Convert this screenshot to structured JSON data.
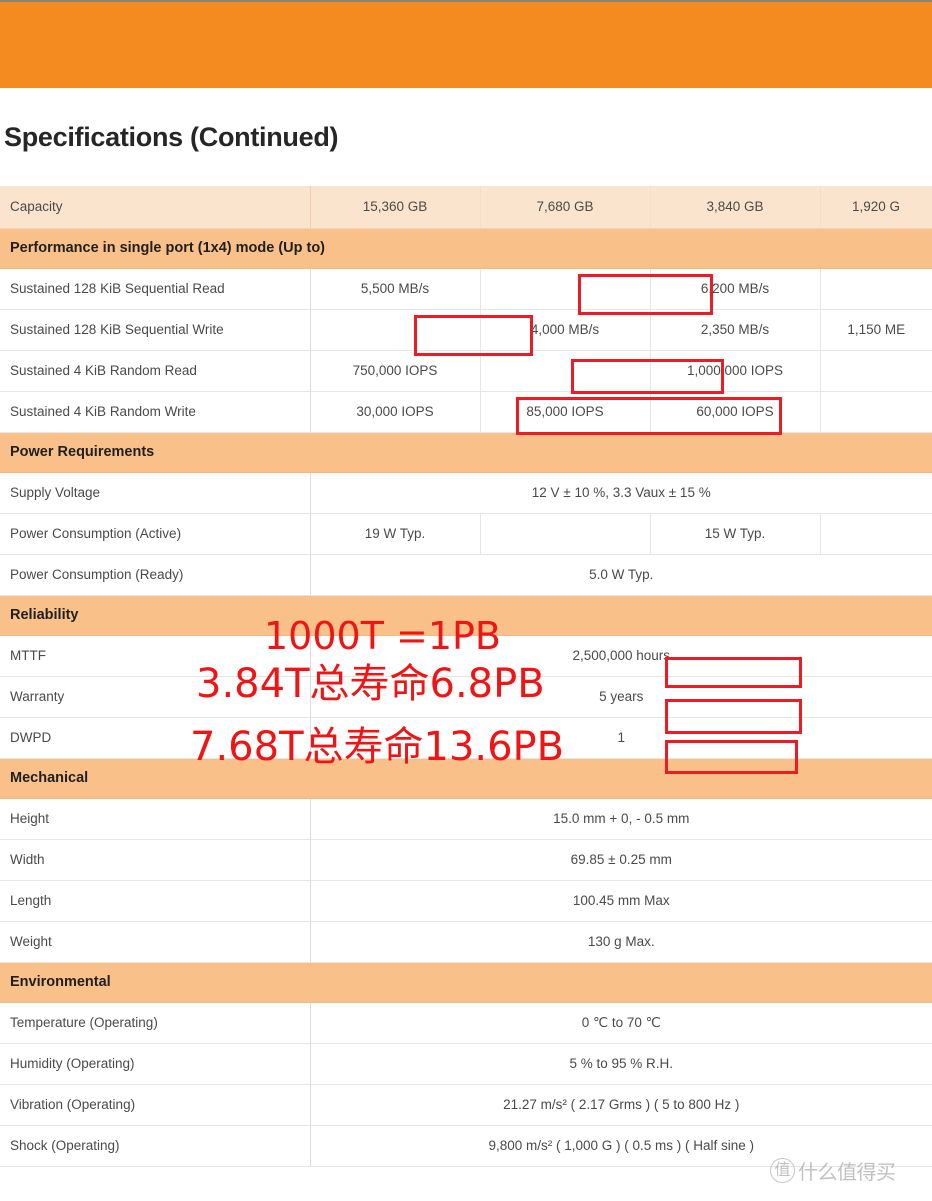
{
  "banner": {
    "color": "#F38B21"
  },
  "page_title": "Specifications (Continued)",
  "table": {
    "capacity_row": {
      "label": "Capacity",
      "values": [
        "15,360 GB",
        "7,680 GB",
        "3,840 GB",
        "1,920 G"
      ]
    },
    "sections": [
      {
        "header": "Performance in single port (1x4) mode (Up to)",
        "rows": [
          {
            "label": "Sustained 128 KiB Sequential Read",
            "cells": [
              "5,500 MB/s",
              "",
              "6,200 MB/s",
              ""
            ]
          },
          {
            "label": "Sustained 128 KiB Sequential Write",
            "cells": [
              "",
              "4,000 MB/s",
              "2,350 MB/s",
              "1,150 ME"
            ]
          },
          {
            "label": "Sustained 4 KiB Random Read",
            "cells": [
              "750,000 IOPS",
              "",
              "1,000,000 IOPS",
              ""
            ]
          },
          {
            "label": "Sustained 4 KiB Random Write",
            "cells": [
              "30,000 IOPS",
              "85,000 IOPS",
              "60,000 IOPS",
              ""
            ]
          }
        ]
      },
      {
        "header": "Power Requirements",
        "rows": [
          {
            "label": "Supply Voltage",
            "merged": "12 V ± 10 %, 3.3 Vaux ± 15 %"
          },
          {
            "label": "Power Consumption (Active)",
            "cells": [
              "19 W Typ.",
              "",
              "15 W Typ.",
              ""
            ]
          },
          {
            "label": "Power Consumption (Ready)",
            "merged": "5.0 W Typ."
          }
        ]
      },
      {
        "header": "Reliability",
        "rows": [
          {
            "label": "MTTF",
            "merged": "2,500,000 hours"
          },
          {
            "label": "Warranty",
            "merged": "5 years"
          },
          {
            "label": "DWPD",
            "merged": "1"
          }
        ]
      },
      {
        "header": "Mechanical",
        "rows": [
          {
            "label": "Height",
            "merged": "15.0 mm + 0,  - 0.5 mm"
          },
          {
            "label": "Width",
            "merged": "69.85 ± 0.25 mm"
          },
          {
            "label": "Length",
            "merged": "100.45 mm Max"
          },
          {
            "label": "Weight",
            "merged": "130 g Max."
          }
        ]
      },
      {
        "header": "Environmental",
        "rows": [
          {
            "label": "Temperature (Operating)",
            "merged": "0 ℃ to 70 ℃"
          },
          {
            "label": "Humidity  (Operating)",
            "merged": "5 % to 95 % R.H."
          },
          {
            "label": "Vibration (Operating)",
            "merged": "21.27 m/s² ( 2.17 Grms ) ( 5 to 800 Hz )"
          },
          {
            "label": "Shock (Operating)",
            "merged": "9,800 m/s² ( 1,000 G ) ( 0.5 ms ) ( Half sine )"
          }
        ]
      }
    ]
  },
  "annotations": {
    "color": "#ED1C24",
    "overlay_lines": [
      "1000T =1PB",
      "3.84T总寿命6.8PB",
      "7.68T总寿命13.6PB"
    ]
  },
  "watermark": {
    "mark": "值",
    "text": "什么值得买"
  }
}
